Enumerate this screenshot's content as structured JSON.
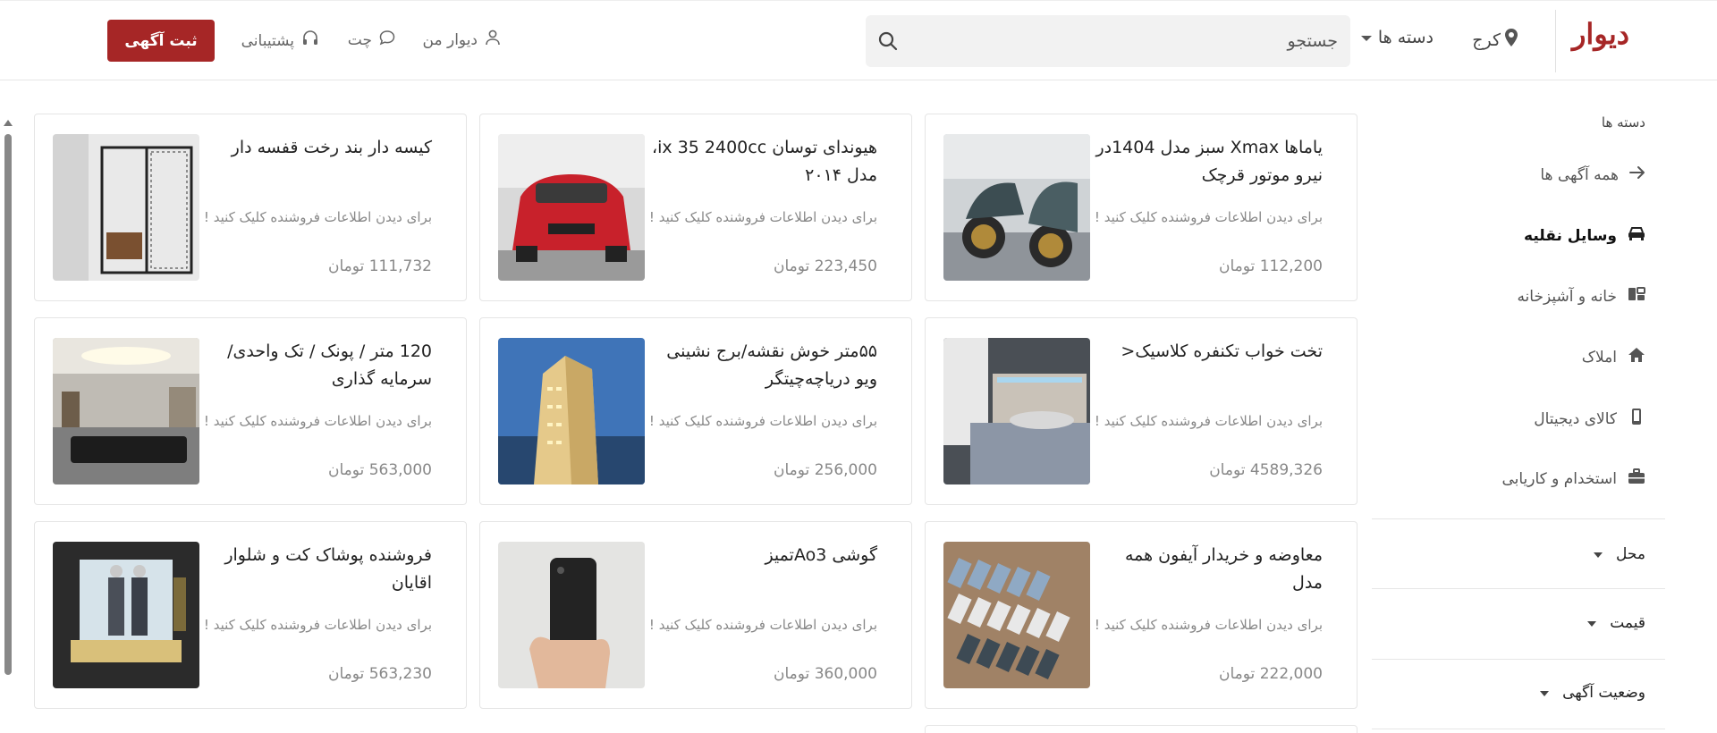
{
  "header": {
    "logo": "دیوار",
    "city": "کرج",
    "categories": "دسته ها",
    "search_placeholder": "جستجو",
    "my_divar": "دیوار من",
    "chat": "چت",
    "support": "پشتیبانی",
    "post_ad": "ثبت آگهی",
    "accent_color": "#a62626"
  },
  "sidebar": {
    "title": "دسته ها",
    "items": [
      {
        "label": "همه آگهی ها",
        "icon": "arrow-right-icon"
      },
      {
        "label": "وسایل نقلیه",
        "icon": "car-icon"
      },
      {
        "label": "خانه و آشپزخانه",
        "icon": "home-kitchen-icon"
      },
      {
        "label": "املاک",
        "icon": "house-icon"
      },
      {
        "label": "کالای دیجیتال",
        "icon": "phone-icon"
      },
      {
        "label": "استخدام و کاریابی",
        "icon": "briefcase-icon"
      }
    ],
    "filters": [
      "محل",
      "قیمت",
      "وضعیت آگهی"
    ]
  },
  "listings": [
    {
      "title": "یاماها Xmax سبز مدل 1404در نیرو موتور قرچک",
      "info": "برای دیدن اطلاعات فروشنده کلیک کنید !",
      "price": "112,200 تومان"
    },
    {
      "title": "هیوندای توسان ix 35 2400cc، مدل ۲۰۱۴",
      "info": "برای دیدن اطلاعات فروشنده کلیک کنید !",
      "price": "223,450 تومان"
    },
    {
      "title": "کیسه دار بند رخت قفسه دار",
      "info": "برای دیدن اطلاعات فروشنده کلیک کنید !",
      "price": "111,732 تومان"
    },
    {
      "title": "تخت خواب تکنفره کلاسیک<",
      "info": "برای دیدن اطلاعات فروشنده کلیک کنید !",
      "price": "4589,326 تومان"
    },
    {
      "title": "۵۵متر خوش نقشه/برج نشینی ویو دریاچه‌چیتگر",
      "info": "برای دیدن اطلاعات فروشنده کلیک کنید !",
      "price": "256,000 تومان"
    },
    {
      "title": "120 متر / پونک / تک واحدی/ سرمایه گذاری",
      "info": "برای دیدن اطلاعات فروشنده کلیک کنید !",
      "price": "563,000 تومان"
    },
    {
      "title": "معاوضه و خریدار آیفون همه مدل",
      "info": "برای دیدن اطلاعات فروشنده کلیک کنید !",
      "price": "222,000 تومان"
    },
    {
      "title": "گوشی Ao3تمیز",
      "info": "برای دیدن اطلاعات فروشنده کلیک کنید !",
      "price": "360,000 تومان"
    },
    {
      "title": "فروشنده پوشاک کت و شلوار اقایان",
      "info": "برای دیدن اطلاعات فروشنده کلیک کنید !",
      "price": "563,230 تومان"
    }
  ]
}
